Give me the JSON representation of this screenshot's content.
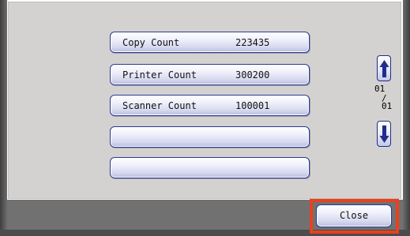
{
  "counters": [
    {
      "label": "Copy Count",
      "value": "223435"
    },
    {
      "label": "Printer Count",
      "value": "300200"
    },
    {
      "label": "Scanner Count",
      "value": "100001"
    },
    {
      "label": "",
      "value": ""
    },
    {
      "label": "",
      "value": ""
    }
  ],
  "pagination": {
    "current": "01",
    "separator": "/",
    "total": "01",
    "up_icon": "arrow-up-icon",
    "down_icon": "arrow-down-icon"
  },
  "footer": {
    "close_label": "Close"
  },
  "colors": {
    "panel_bg": "#d4d2d0",
    "footer_bg": "#727171",
    "button_border": "#2b3a8f",
    "highlight": "#e8411f"
  }
}
